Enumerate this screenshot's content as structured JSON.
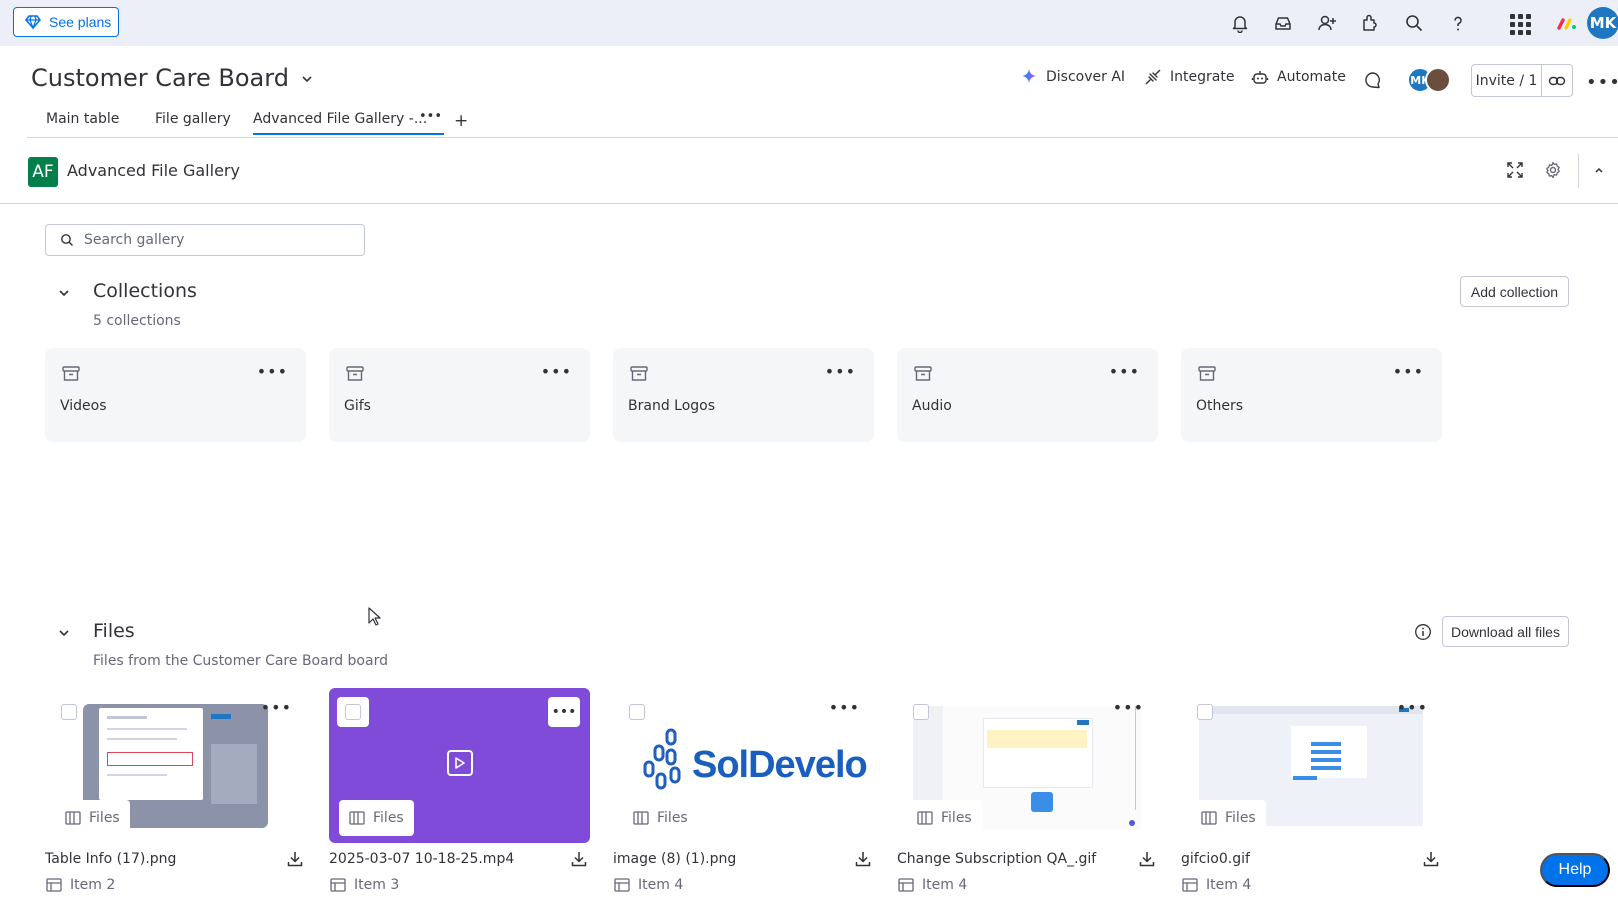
{
  "topbar": {
    "see_plans_label": "See plans",
    "icons": [
      "bell-icon",
      "inbox-icon",
      "invite-members-icon",
      "apps-icon",
      "search-icon",
      "help-icon",
      "apps-grid-icon",
      "monday-logo"
    ],
    "avatar_initials": "MK"
  },
  "board": {
    "title": "Customer Care Board",
    "actions": {
      "discover_ai": "Discover AI",
      "integrate": "Integrate",
      "automate": "Automate"
    },
    "avatar_initials": "MK",
    "invite_label": "Invite / 1"
  },
  "tabs": [
    {
      "label": "Main table"
    },
    {
      "label": "File gallery"
    },
    {
      "label": "Advanced File Gallery -...",
      "active": true
    }
  ],
  "widget": {
    "badge": "AF",
    "title": "Advanced File Gallery"
  },
  "search": {
    "placeholder": "Search gallery"
  },
  "collections": {
    "title": "Collections",
    "subtitle": "5 collections",
    "add_label": "Add collection",
    "items": [
      {
        "name": "Videos"
      },
      {
        "name": "Gifs"
      },
      {
        "name": "Brand Logos"
      },
      {
        "name": "Audio"
      },
      {
        "name": "Others"
      }
    ]
  },
  "files": {
    "title": "Files",
    "subtitle": "Files from the Customer Care Board board",
    "download_all_label": "Download all files",
    "chip_label": "Files",
    "items": [
      {
        "name": "Table Info (17).png",
        "item": "Item 2"
      },
      {
        "name": "2025-03-07 10-18-25.mp4",
        "item": "Item 3"
      },
      {
        "name": "image (8) (1).png",
        "item": "Item 4",
        "logo_text": "SolDevelo"
      },
      {
        "name": "Change Subscription QA_.gif",
        "item": "Item 4"
      },
      {
        "name": "gifcio0.gif",
        "item": "Item 4"
      }
    ]
  },
  "help_label": "Help",
  "colors": {
    "accent": "#0073ea",
    "video_tile": "#7f4bd8",
    "af_badge": "#037f4c",
    "topbar_bg": "#eceff8"
  }
}
